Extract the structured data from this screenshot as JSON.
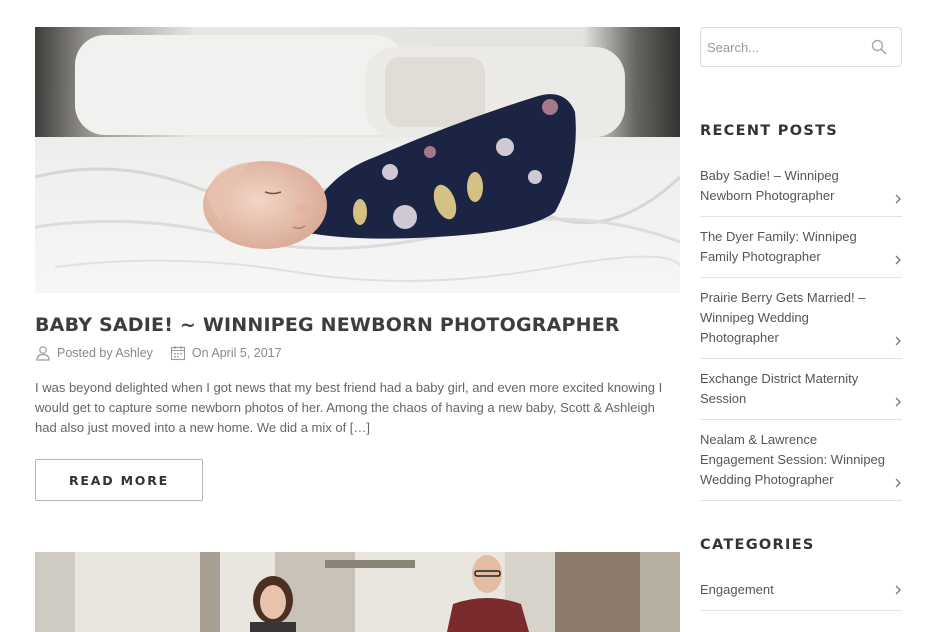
{
  "post": {
    "title": "BABY SADIE! ~ WINNIPEG NEWBORN PHOTOGRAPHER",
    "posted_by": "Posted by Ashley",
    "date": "On April 5, 2017",
    "excerpt": "I was beyond delighted when I got news that my best friend had a baby girl, and even more excited knowing I would get to capture some newborn photos of her.  Among the chaos of having a new baby, Scott & Ashleigh had also just moved into a new home.  We did a mix of […]",
    "read_more": "READ MORE",
    "hero_icon": "newborn-photo",
    "author_icon": "user-icon",
    "date_icon": "calendar-icon"
  },
  "sidebar": {
    "search_placeholder": "Search...",
    "recent_posts_title": "RECENT POSTS",
    "recent_posts": [
      "Baby Sadie! – Winnipeg Newborn Photographer",
      "The Dyer Family: Winnipeg Family Photographer",
      "Prairie Berry Gets Married! – Winnipeg Wedding Photographer",
      "Exchange District Maternity Session",
      "Nealam & Lawrence Engagement Session: Winnipeg Wedding Photographer"
    ],
    "categories_title": "CATEGORIES",
    "categories": [
      "Engagement"
    ]
  }
}
